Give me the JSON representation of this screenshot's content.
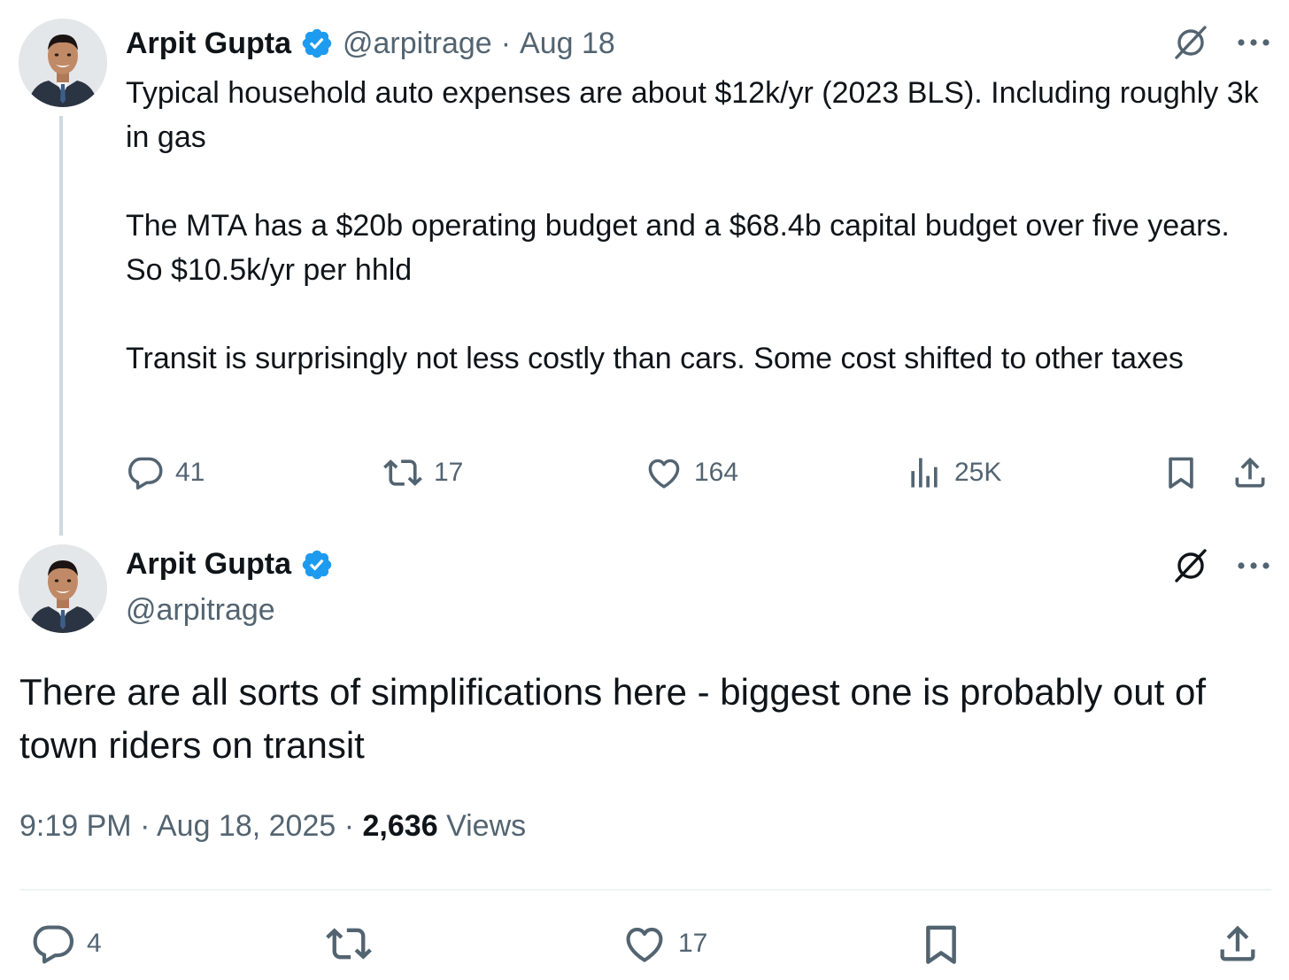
{
  "tweet1": {
    "author_name": "Arpit Gupta",
    "handle": "@arpitrage",
    "separator": "·",
    "date": "Aug 18",
    "text": "Typical household auto expenses are about $12k/yr (2023 BLS). Including roughly 3k in gas\n\nThe MTA has a $20b operating budget and a $68.4b capital budget over five years. So $10.5k/yr per hhld\n\nTransit is surprisingly not less costly than cars. Some cost shifted to other taxes",
    "replies": "41",
    "reposts": "17",
    "likes": "164",
    "views": "25K"
  },
  "tweet2": {
    "author_name": "Arpit Gupta",
    "handle": "@arpitrage",
    "text": "There are all sorts of simplifications here - biggest one is probably out of town riders on transit",
    "time": "9:19 PM",
    "separator1": "·",
    "date": "Aug 18, 2025",
    "separator2": "·",
    "views_count": "2,636",
    "views_label": "Views",
    "replies": "4",
    "likes": "17"
  },
  "icons": [
    "reply-icon",
    "repost-icon",
    "like-icon",
    "views-icon",
    "bookmark-icon",
    "share-icon",
    "grok-icon",
    "more-icon",
    "verified-badge-icon"
  ],
  "colors": {
    "text": "#0f1419",
    "secondary": "#536471",
    "verified": "#1d9bf0",
    "thread_line": "#cfd9de",
    "divider": "#eff3f4"
  }
}
